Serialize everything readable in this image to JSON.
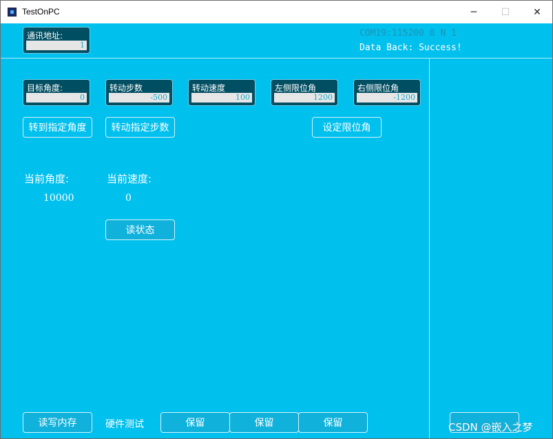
{
  "window": {
    "title": "TestOnPC",
    "minimize_glyph": "─",
    "maximize_glyph": "☐",
    "close_glyph": "✕"
  },
  "header": {
    "address": {
      "label": "通讯地址:",
      "value": "1"
    },
    "port_status": "COM19:115200 8 N 1",
    "data_back": "Data Back: Success!"
  },
  "fields": [
    {
      "label": "目标角度:",
      "value": "0"
    },
    {
      "label": "转动步数",
      "value": "-500"
    },
    {
      "label": "转动速度",
      "value": "100"
    },
    {
      "label": "左侧限位角",
      "value": "1200"
    },
    {
      "label": "右侧限位角",
      "value": "-1200"
    }
  ],
  "buttons": {
    "goto_angle": "转到指定角度",
    "rotate_steps": "转动指定步数",
    "set_limit": "设定限位角",
    "read_status": "读状态",
    "write_memory": "读写内存",
    "reserve1": "保留",
    "reserve2": "保留",
    "reserve3": "保留"
  },
  "readings": {
    "angle_label": "当前角度:",
    "angle_value": "10000",
    "speed_label": "当前速度:",
    "speed_value": "0"
  },
  "hardware_test": "硬件测试",
  "watermark": "CSDN @嵌入之梦",
  "colors": {
    "background": "#00c0ee",
    "field_bg": "#004e62",
    "port_status": "#1e93b3",
    "data_back": "#ffffff"
  }
}
